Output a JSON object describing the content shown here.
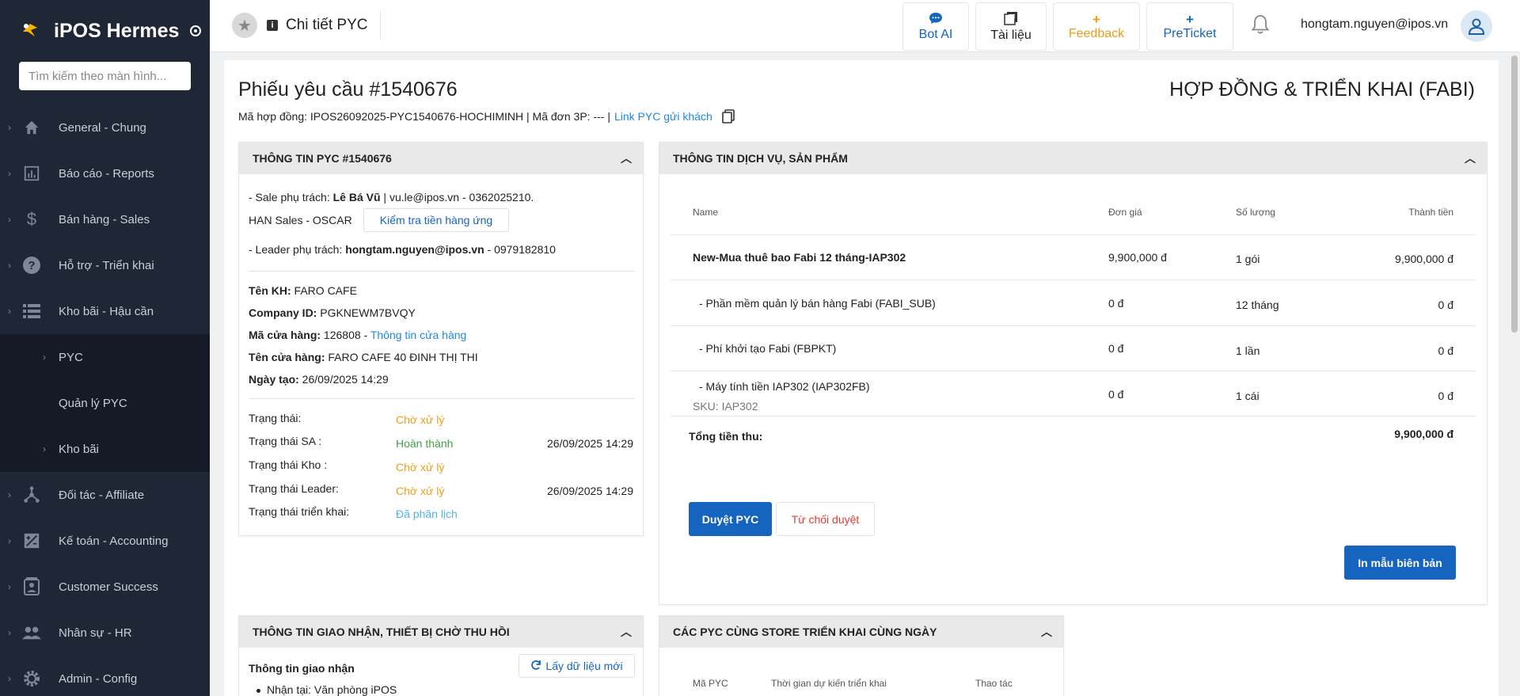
{
  "sidebar": {
    "brand": "iPOS Hermes",
    "search_placeholder": "Tìm kiếm theo màn hình...",
    "items": [
      {
        "label": "General - Chung",
        "icon": "home-icon"
      },
      {
        "label": "Báo cáo - Reports",
        "icon": "report-icon"
      },
      {
        "label": "Bán hàng - Sales",
        "icon": "dollar-icon"
      },
      {
        "label": "Hỗ trợ - Triển khai",
        "icon": "help-icon"
      },
      {
        "label": "Kho bãi - Hậu cần",
        "icon": "list-icon"
      }
    ],
    "sub_items": [
      {
        "label": "PYC"
      },
      {
        "label": "Quản lý PYC"
      },
      {
        "label": "Kho bãi"
      }
    ],
    "items_after": [
      {
        "label": "Đối tác - Affiliate",
        "icon": "affiliate-icon"
      },
      {
        "label": "Kế toán - Accounting",
        "icon": "accounting-icon"
      },
      {
        "label": "Customer Success",
        "icon": "customer-icon"
      },
      {
        "label": "Nhân sự - HR",
        "icon": "people-icon"
      },
      {
        "label": "Admin - Config",
        "icon": "gear-icon"
      }
    ]
  },
  "header": {
    "title": "Chi tiết PYC",
    "buttons": [
      {
        "icon": "chat-icon",
        "label": "Bot AI",
        "color": "#1565c0"
      },
      {
        "icon": "docs-icon",
        "label": "Tài liệu",
        "color": "#222222"
      },
      {
        "icon": "plus-icon",
        "label": "Feedback",
        "color": "#f39c12"
      },
      {
        "icon": "plus-icon",
        "label": "PreTicket",
        "color": "#1565c0"
      }
    ],
    "user_email": "hongtam.nguyen@ipos.vn"
  },
  "page": {
    "title": "Phiếu yêu cầu #1540676",
    "right_title": "HỢP ĐỒNG & TRIỂN KHAI (FABI)",
    "contract_line": "Mã hợp đồng: IPOS26092025-PYC1540676-HOCHIMINH | Mã đơn 3P: --- |",
    "contract_link": "Link PYC gửi khách"
  },
  "pyc_card": {
    "title": "THÔNG TIN PYC #1540676",
    "sale_prefix": "- Sale phụ trách: ",
    "sale_name": "Lê Bá Vũ",
    "sale_suffix": " | vu.le@ipos.vn - 0362025210.",
    "sales_team": "HAN Sales - OSCAR",
    "check_button": "Kiểm tra tiền hàng ứng",
    "leader_prefix": "- Leader phụ trách: ",
    "leader_email": "hongtam.nguyen@ipos.vn",
    "leader_suffix": " - 0979182810",
    "customer_label": "Tên KH:",
    "customer_value": " FARO CAFE",
    "company_label": "Company ID:",
    "company_value": " PGKNEWM7BVQY",
    "store_code_label": "Mã cửa hàng:",
    "store_code_value": " 126808 - ",
    "store_info_link": "Thông tin cửa hàng",
    "store_name_label": "Tên cửa hàng:",
    "store_name_value": " FARO CAFE 40 ĐINH THỊ THI",
    "created_label": "Ngày tạo:",
    "created_value": " 26/09/2025 14:29",
    "statuses": [
      {
        "label": "Trạng thái:",
        "value": "Chờ xử lý",
        "color": "#f39c12",
        "date": ""
      },
      {
        "label": "Trạng thái SA :",
        "value": "Hoàn thành",
        "color": "#43a047",
        "date": "26/09/2025 14:29"
      },
      {
        "label": "Trạng thái Kho :",
        "value": "Chờ xử lý",
        "color": "#f39c12",
        "date": ""
      },
      {
        "label": "Trạng thái Leader:",
        "value": "Chờ xử lý",
        "color": "#f39c12",
        "date": "26/09/2025 14:29"
      },
      {
        "label": "Trạng thái triển khai:",
        "value": "Đã phân lịch",
        "color": "#4fb3e8",
        "date": ""
      }
    ]
  },
  "service_card": {
    "title": "THÔNG TIN DỊCH VỤ, SẢN PHẨM",
    "columns": [
      "Name",
      "Đơn giá",
      "Số lượng",
      "Thành tiền"
    ],
    "rows": [
      {
        "name": "New-Mua thuê bao Fabi 12 tháng-IAP302",
        "sku": "",
        "price": "9,900,000 đ",
        "qty": "1 gói",
        "total": "9,900,000 đ",
        "bold": true
      },
      {
        "name": "- Phần mềm quản lý bán hàng Fabi (FABI_SUB)",
        "sku": "",
        "price": "0 đ",
        "qty": "12 tháng",
        "total": "0 đ",
        "bold": false
      },
      {
        "name": "- Phí khởi tạo Fabi (FBPKT)",
        "sku": "",
        "price": "0 đ",
        "qty": "1 lần",
        "total": "0 đ",
        "bold": false
      },
      {
        "name": "- Máy tính tiền IAP302 (IAP302FB)",
        "sku": "SKU: IAP302",
        "price": "0 đ",
        "qty": "1 cái",
        "total": "0 đ",
        "bold": false
      }
    ],
    "total_label": "Tổng tiền thu:",
    "total_value": "9,900,000 đ",
    "approve_button": "Duyệt PYC",
    "reject_button": "Từ chối duyệt",
    "print_button": "In mẫu biên bản"
  },
  "delivery_card": {
    "title": "THÔNG TIN GIAO NHẬN, THIẾT BỊ CHỜ THU HỒI",
    "subtitle": "Thông tin giao nhận",
    "refresh_button": "Lấy dữ liệu mới",
    "bullet": "Nhận tại: Văn phòng iPOS"
  },
  "same_store_card": {
    "title": "CÁC PYC CÙNG STORE TRIỂN KHAI CÙNG NGÀY",
    "columns": [
      "Mã PYC",
      "Thời gian dự kiến triển khai",
      "Thao tác"
    ]
  }
}
